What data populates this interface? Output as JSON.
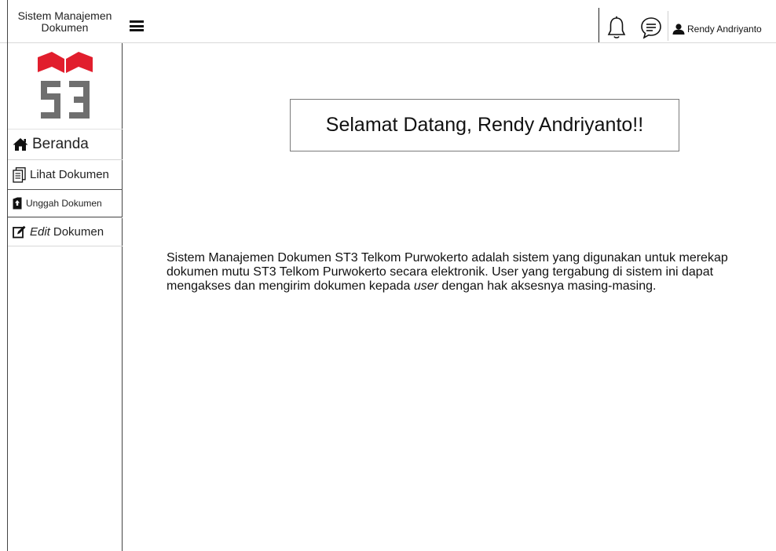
{
  "header": {
    "app_title_line1": "Sistem Manajemen",
    "app_title_line2": "Dokumen",
    "menu_icon": "hamburger-icon",
    "notification_icon": "bell-icon",
    "message_icon": "chat-bubble-icon",
    "user_icon": "user-icon",
    "user_name": "Rendy Andriyanto"
  },
  "sidebar": {
    "logo": "ST3 Telkom logo",
    "items": [
      {
        "icon": "home-icon",
        "label": "Beranda"
      },
      {
        "icon": "documents-icon",
        "label": "Lihat Dokumen"
      },
      {
        "icon": "upload-file-icon",
        "label": "Unggah Dokumen"
      },
      {
        "icon": "edit-icon",
        "label_em": "Edit",
        "label_rest": "Dokumen"
      }
    ]
  },
  "main": {
    "welcome": "Selamat Datang, Rendy Andriyanto!!",
    "description_part1": "Sistem Manajemen Dokumen ST3 Telkom Purwokerto adalah sistem yang digunakan untuk merekap dokumen mutu ST3 Telkom Purwokerto secara elektronik. User yang tergabung di sistem ini dapat mengakses dan mengirim dokumen kepada ",
    "description_em": "user",
    "description_part2": " dengan hak aksesnya masing-masing."
  },
  "colors": {
    "logo_red": "#e11e2d",
    "logo_grey": "#6f6f6f"
  }
}
